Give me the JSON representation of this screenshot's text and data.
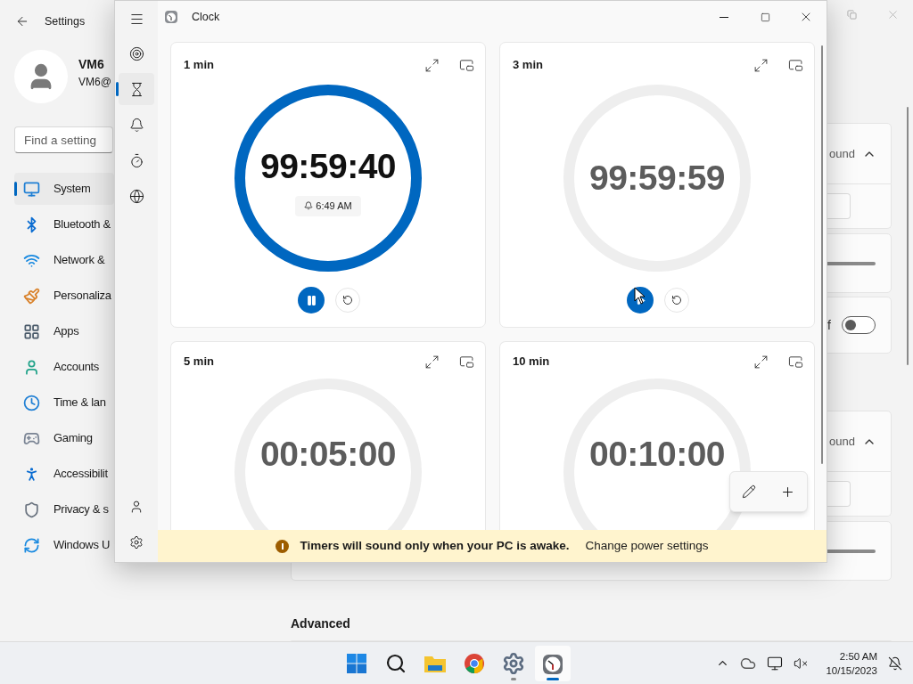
{
  "settings": {
    "title": "Settings",
    "user": {
      "name": "VM6",
      "email": "VM6@"
    },
    "search": {
      "placeholder": "Find a setting"
    },
    "nav": [
      {
        "kind": "system",
        "label": "System",
        "selected": true
      },
      {
        "kind": "bluetooth",
        "label": "Bluetooth &",
        "selected": false
      },
      {
        "kind": "network",
        "label": "Network &",
        "selected": false
      },
      {
        "kind": "personalization",
        "label": "Personaliza",
        "selected": false
      },
      {
        "kind": "apps",
        "label": "Apps",
        "selected": false
      },
      {
        "kind": "accounts",
        "label": "Accounts",
        "selected": false
      },
      {
        "kind": "time",
        "label": "Time & lan",
        "selected": false
      },
      {
        "kind": "gaming",
        "label": "Gaming",
        "selected": false
      },
      {
        "kind": "accessibility",
        "label": "Accessibilit",
        "selected": false
      },
      {
        "kind": "privacy",
        "label": "Privacy & s",
        "selected": false
      },
      {
        "kind": "update",
        "label": "Windows U",
        "selected": false
      }
    ],
    "groups": [
      {
        "rows": [
          {
            "kind": "header",
            "text": "ound"
          },
          {
            "kind": "field"
          },
          {
            "kind": "slider"
          },
          {
            "kind": "toggle",
            "text": "f",
            "on": false
          }
        ]
      },
      {
        "rows": [
          {
            "kind": "header",
            "text": "ound"
          },
          {
            "kind": "field"
          },
          {
            "kind": "slider"
          }
        ]
      }
    ],
    "section_heading": "Advanced"
  },
  "clock": {
    "title": "Clock",
    "rail": [
      {
        "kind": "focus",
        "selected": false
      },
      {
        "kind": "timer",
        "selected": true
      },
      {
        "kind": "alarm",
        "selected": false
      },
      {
        "kind": "stopwatch",
        "selected": false
      },
      {
        "kind": "world",
        "selected": false
      }
    ],
    "rail_bottom": [
      {
        "kind": "account"
      },
      {
        "kind": "settings"
      }
    ],
    "timers": [
      {
        "title": "1 min",
        "time": "99:59:40",
        "alarm": "6:49 AM",
        "running": true
      },
      {
        "title": "3 min",
        "time": "99:59:59",
        "running": false
      },
      {
        "title": "5 min",
        "time": "00:05:00"
      },
      {
        "title": "10 min",
        "time": "00:10:00"
      }
    ],
    "banner": {
      "message": "Timers will sound only when your PC is awake.",
      "link": "Change power settings"
    }
  },
  "taskbar": {
    "apps": [
      {
        "kind": "start",
        "running": false,
        "active": false
      },
      {
        "kind": "search",
        "running": false,
        "active": false
      },
      {
        "kind": "explorer",
        "running": false,
        "active": false
      },
      {
        "kind": "chrome",
        "running": false,
        "active": false
      },
      {
        "kind": "settings",
        "running": true,
        "active": false
      },
      {
        "kind": "clock",
        "running": true,
        "active": true
      }
    ],
    "time": "2:50 AM",
    "date": "10/15/2023"
  }
}
